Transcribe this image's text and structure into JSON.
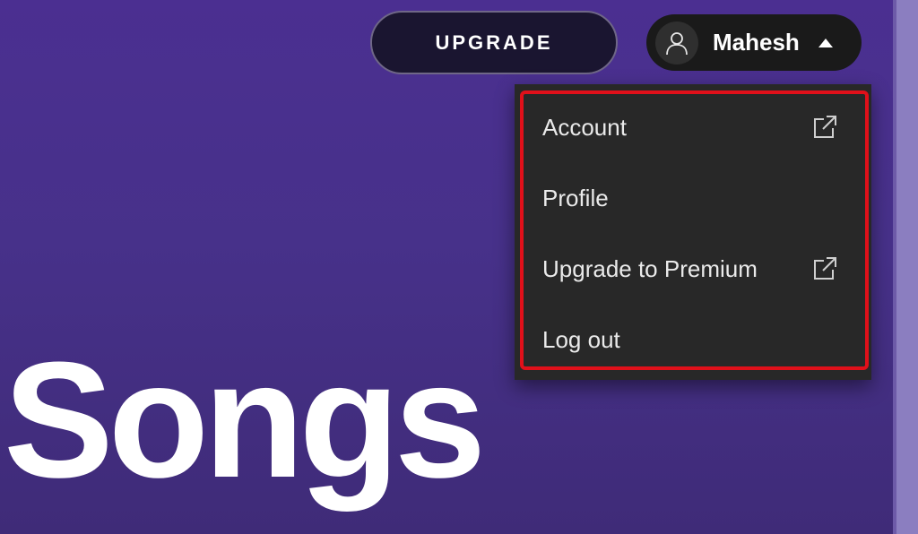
{
  "header": {
    "upgrade_label": "UPGRADE",
    "user": {
      "name": "Mahesh",
      "avatar_icon": "user-icon",
      "caret_icon": "caret-up-icon"
    }
  },
  "user_menu": {
    "items": [
      {
        "label": "Account",
        "icon": "external-link-icon"
      },
      {
        "label": "Profile"
      },
      {
        "label": "Upgrade to Premium",
        "icon": "external-link-icon"
      },
      {
        "label": "Log out"
      }
    ],
    "highlight_color": "#e0101a"
  },
  "main": {
    "title": "Songs"
  },
  "colors": {
    "background": "#4b2f91",
    "menu_background": "#282828",
    "button_dark": "#1a1530"
  }
}
